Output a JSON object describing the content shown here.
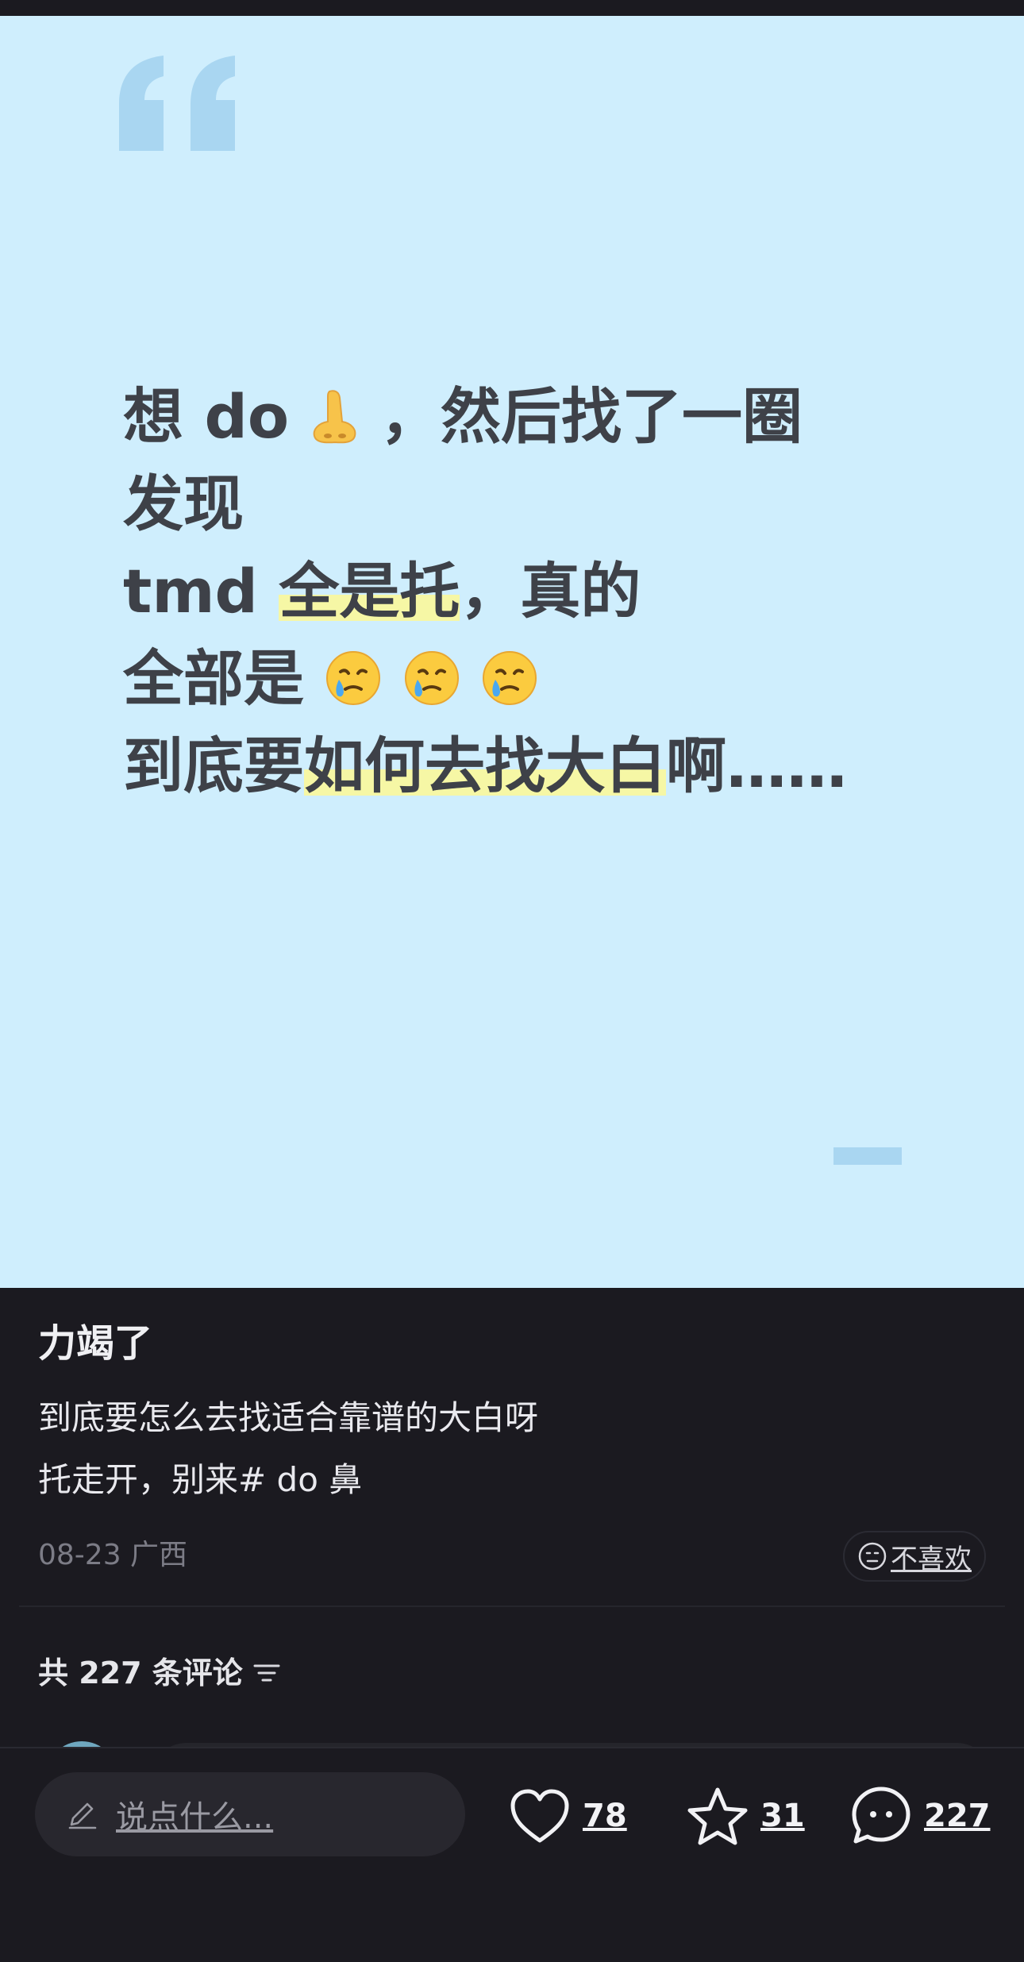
{
  "card": {
    "lines": [
      {
        "pre": "想 do",
        "emoji": "nose",
        "post": "，然后找了一圈"
      },
      {
        "text": "发现"
      },
      {
        "pre": "tmd ",
        "hl": "全是托",
        "post": "，真的"
      },
      {
        "pre": "全部是",
        "emoji_count": 3
      },
      {
        "pre": "到底要",
        "hl": "如何去找大白",
        "post": "啊……"
      }
    ]
  },
  "post": {
    "title": "力竭了",
    "body_line1": "到底要怎么去找适合靠谱的大白呀",
    "body_line2": "托走开，别来# do 鼻",
    "meta": "08-23 广西",
    "dislike_label": "不喜欢"
  },
  "comments": {
    "header": "共 227 条评论"
  },
  "bottom_bar": {
    "input_placeholder": "说点什么...",
    "likes": "78",
    "favorites": "31",
    "comments": "227"
  },
  "colors": {
    "card_bg": "#cfeefd",
    "highlight": "#f6f7a5",
    "app_bg": "#1b1a20"
  }
}
